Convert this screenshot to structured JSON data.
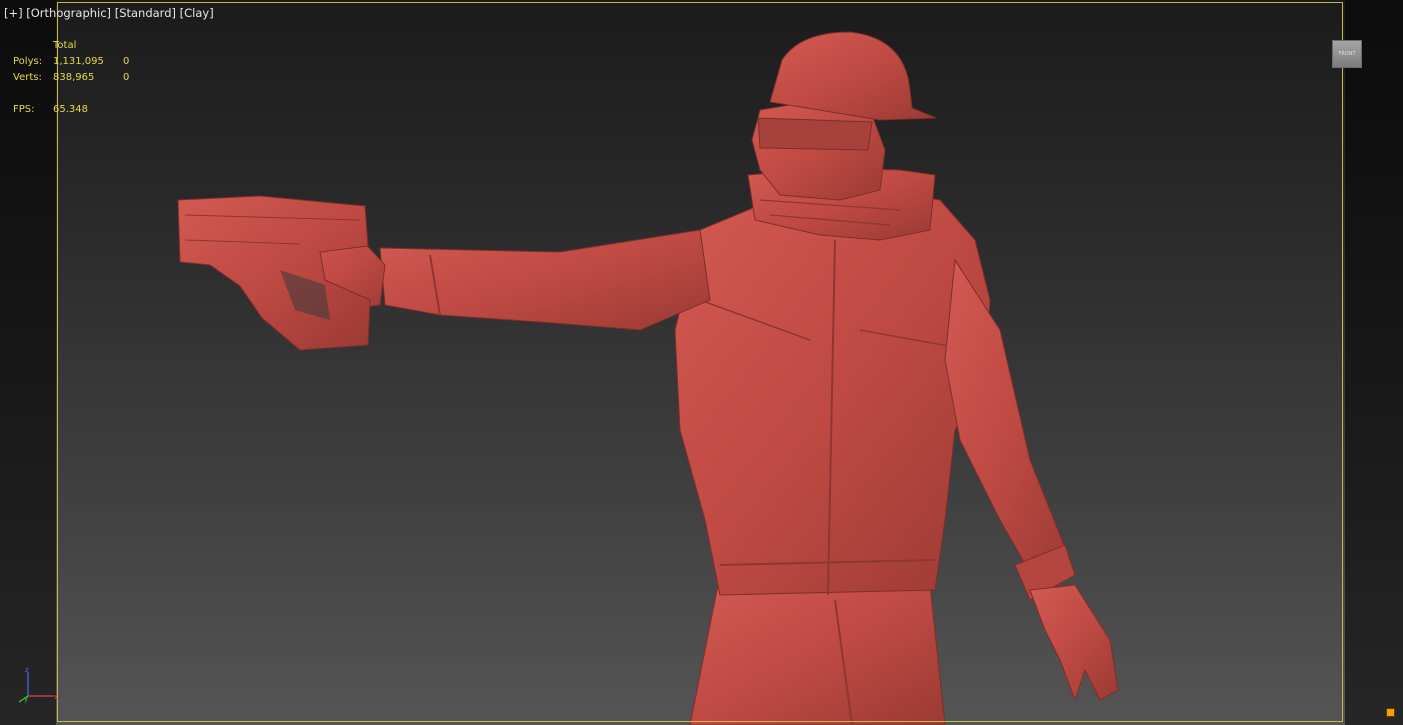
{
  "viewport": {
    "labels": [
      "[+]",
      "[Orthographic]",
      "[Standard]",
      "[Clay]"
    ],
    "background_top": "#1b1b1b",
    "background_bottom": "#555555"
  },
  "stats": {
    "header": "Total",
    "polys_label": "Polys:",
    "polys_total": "1,131,095",
    "polys_selected": "0",
    "verts_label": "Verts:",
    "verts_total": "838,965",
    "verts_selected": "0",
    "fps_label": "FPS:",
    "fps_value": "65.348",
    "color": "#e7d84a"
  },
  "viewcube": {
    "face": "FRONT"
  },
  "axis": {
    "z": "z",
    "y": "y",
    "x": "x"
  },
  "model": {
    "clay_color": "#c4514a"
  },
  "icons": {
    "corner": "viewport-config-icon",
    "tripod": "axis-tripod-icon"
  }
}
